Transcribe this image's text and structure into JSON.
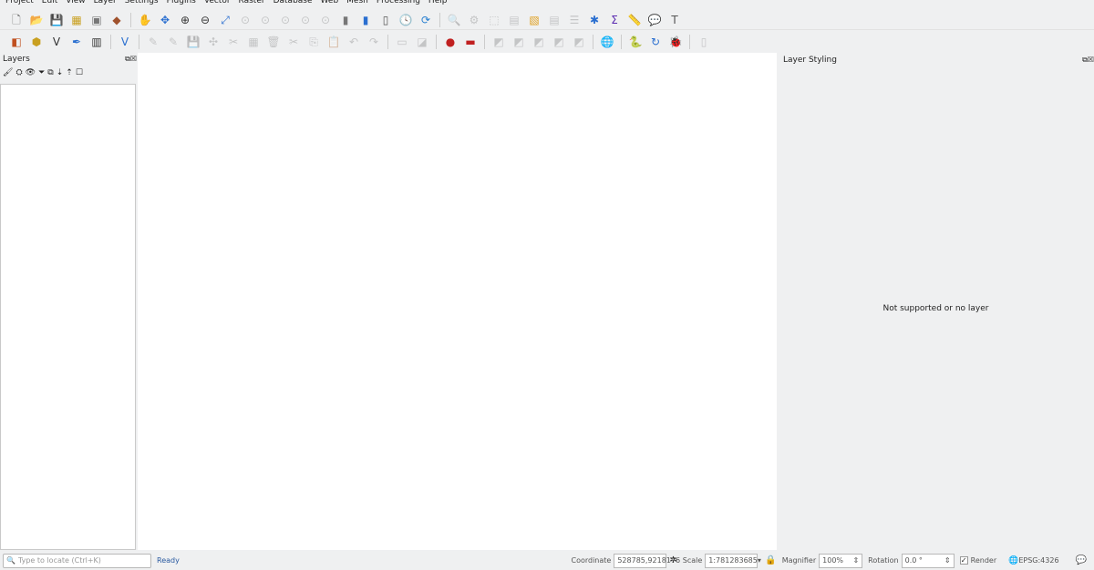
{
  "menu": [
    "Project",
    "Edit",
    "View",
    "Layer",
    "Settings",
    "Plugins",
    "Vector",
    "Raster",
    "Database",
    "Web",
    "Mesh",
    "Processing",
    "Help"
  ],
  "toolbar1": [
    [
      "new-project",
      "🗋",
      0,
      "#666"
    ],
    [
      "open-project",
      "📂",
      0,
      "#e0a020"
    ],
    [
      "save-project",
      "💾",
      0,
      "#555"
    ],
    [
      "new-print-layout",
      "▦",
      0,
      "#c9a020"
    ],
    [
      "layout-manager",
      "▣",
      0,
      "#777"
    ],
    [
      "style-manager",
      "◆",
      0,
      "#a0522d"
    ],
    [
      "sep"
    ],
    [
      "pan",
      "✋",
      0,
      "#333"
    ],
    [
      "pan-to-selection",
      "✥",
      0,
      "#2a6fd0"
    ],
    [
      "zoom-in",
      "⊕",
      0,
      "#333"
    ],
    [
      "zoom-out",
      "⊖",
      0,
      "#333"
    ],
    [
      "zoom-full",
      "⤢",
      0,
      "#2a6fd0"
    ],
    [
      "zoom-selection",
      "⊙",
      1,
      "#777"
    ],
    [
      "zoom-layer",
      "⊙",
      1,
      "#777"
    ],
    [
      "zoom-native",
      "⊙",
      1,
      "#777"
    ],
    [
      "zoom-last",
      "⊙",
      1,
      "#777"
    ],
    [
      "zoom-next",
      "⊙",
      1,
      "#777"
    ],
    [
      "new-bookmark",
      "▮",
      0,
      "#777"
    ],
    [
      "show-bookmarks",
      "▮",
      0,
      "#2a6fd0"
    ],
    [
      "spatial-bookmarks",
      "▯",
      0,
      "#555"
    ],
    [
      "temporal-controller",
      "🕓",
      0,
      "#222"
    ],
    [
      "refresh",
      "⟳",
      0,
      "#2a80d0"
    ],
    [
      "sep"
    ],
    [
      "identify",
      "🔍",
      1,
      "#777"
    ],
    [
      "actions",
      "⚙",
      1,
      "#777"
    ],
    [
      "select",
      "⬚",
      1,
      "#777"
    ],
    [
      "deselect",
      "▤",
      1,
      "#777"
    ],
    [
      "select-value",
      "▧",
      0,
      "#e0a020"
    ],
    [
      "attribute-table",
      "▤",
      1,
      "#777"
    ],
    [
      "field-calculator",
      "☰",
      1,
      "#777"
    ],
    [
      "statistics",
      "✱",
      0,
      "#2a6fd0"
    ],
    [
      "sum",
      "Σ",
      0,
      "#5a2ab0"
    ],
    [
      "measure",
      "📏",
      0,
      "#555"
    ],
    [
      "map-tips",
      "💬",
      0,
      "#e0c020"
    ],
    [
      "text-annotation",
      "T",
      0,
      "#555"
    ]
  ],
  "toolbar2": [
    [
      "data-source-manager",
      "◧",
      0,
      "#c05020"
    ],
    [
      "new-geopackage-layer",
      "⬢",
      0,
      "#c9a020"
    ],
    [
      "new-shapefile-layer",
      "V",
      0,
      "#333"
    ],
    [
      "new-spatialite-layer",
      "✒",
      0,
      "#2a6fd0"
    ],
    [
      "new-virtual-layer",
      "▥",
      0,
      "#333"
    ],
    [
      "sep"
    ],
    [
      "new-gpx-layer",
      "V",
      0,
      "#2a6fd0"
    ],
    [
      "sep"
    ],
    [
      "current-edits",
      "✎",
      1,
      "#777"
    ],
    [
      "toggle-editing",
      "✎",
      1,
      "#777"
    ],
    [
      "save-edits",
      "💾",
      1,
      "#777"
    ],
    [
      "add-feature",
      "✣",
      1,
      "#777"
    ],
    [
      "vertex-tool",
      "✂",
      1,
      "#777"
    ],
    [
      "modify-attributes",
      "▦",
      1,
      "#777"
    ],
    [
      "delete-selected",
      "🗑",
      1,
      "#777"
    ],
    [
      "cut-features",
      "✂",
      1,
      "#777"
    ],
    [
      "copy-features",
      "⎘",
      1,
      "#777"
    ],
    [
      "paste-features",
      "📋",
      1,
      "#777"
    ],
    [
      "undo",
      "↶",
      1,
      "#777"
    ],
    [
      "redo",
      "↷",
      1,
      "#777"
    ],
    [
      "sep"
    ],
    [
      "label-tool",
      "▭",
      1,
      "#777"
    ],
    [
      "pin-labels",
      "◪",
      1,
      "#777"
    ],
    [
      "sep"
    ],
    [
      "highlight-pinned",
      "●",
      0,
      "#c02020"
    ],
    [
      "label-toolbar",
      "▬",
      0,
      "#c02020"
    ],
    [
      "sep"
    ],
    [
      "digitize-1",
      "◩",
      1,
      "#777"
    ],
    [
      "digitize-2",
      "◩",
      1,
      "#777"
    ],
    [
      "digitize-3",
      "◩",
      1,
      "#777"
    ],
    [
      "digitize-4",
      "◩",
      1,
      "#777"
    ],
    [
      "digitize-5",
      "◩",
      1,
      "#777"
    ],
    [
      "sep"
    ],
    [
      "globe",
      "🌐",
      0,
      "#335"
    ],
    [
      "sep"
    ],
    [
      "python-console",
      "🐍",
      0,
      "#2a6fd0"
    ],
    [
      "plugin-reloader",
      "↻",
      0,
      "#2a6fd0"
    ],
    [
      "debug",
      "🐞",
      0,
      "#222"
    ],
    [
      "sep"
    ],
    [
      "panel-toggle",
      "▯",
      1,
      "#777"
    ]
  ],
  "layers": {
    "title": "Layers",
    "tools": [
      "🖌",
      "⛭",
      "👁",
      "⏷",
      "⧉",
      "⇣",
      "⇡",
      "☐"
    ]
  },
  "styling": {
    "title": "Layer Styling",
    "message": "Not supported or no layer"
  },
  "status": {
    "locate_placeholder": "Type to locate (Ctrl+K)",
    "ready": "Ready",
    "coordinate_label": "Coordinate",
    "coordinate_value": "528785,9218176",
    "scale_label": "Scale",
    "scale_value": "1:781283685",
    "magnifier_label": "Magnifier",
    "magnifier_value": "100%",
    "rotation_label": "Rotation",
    "rotation_value": "0.0 °",
    "render_label": "Render",
    "render_checked": true,
    "crs": "EPSG:4326"
  }
}
